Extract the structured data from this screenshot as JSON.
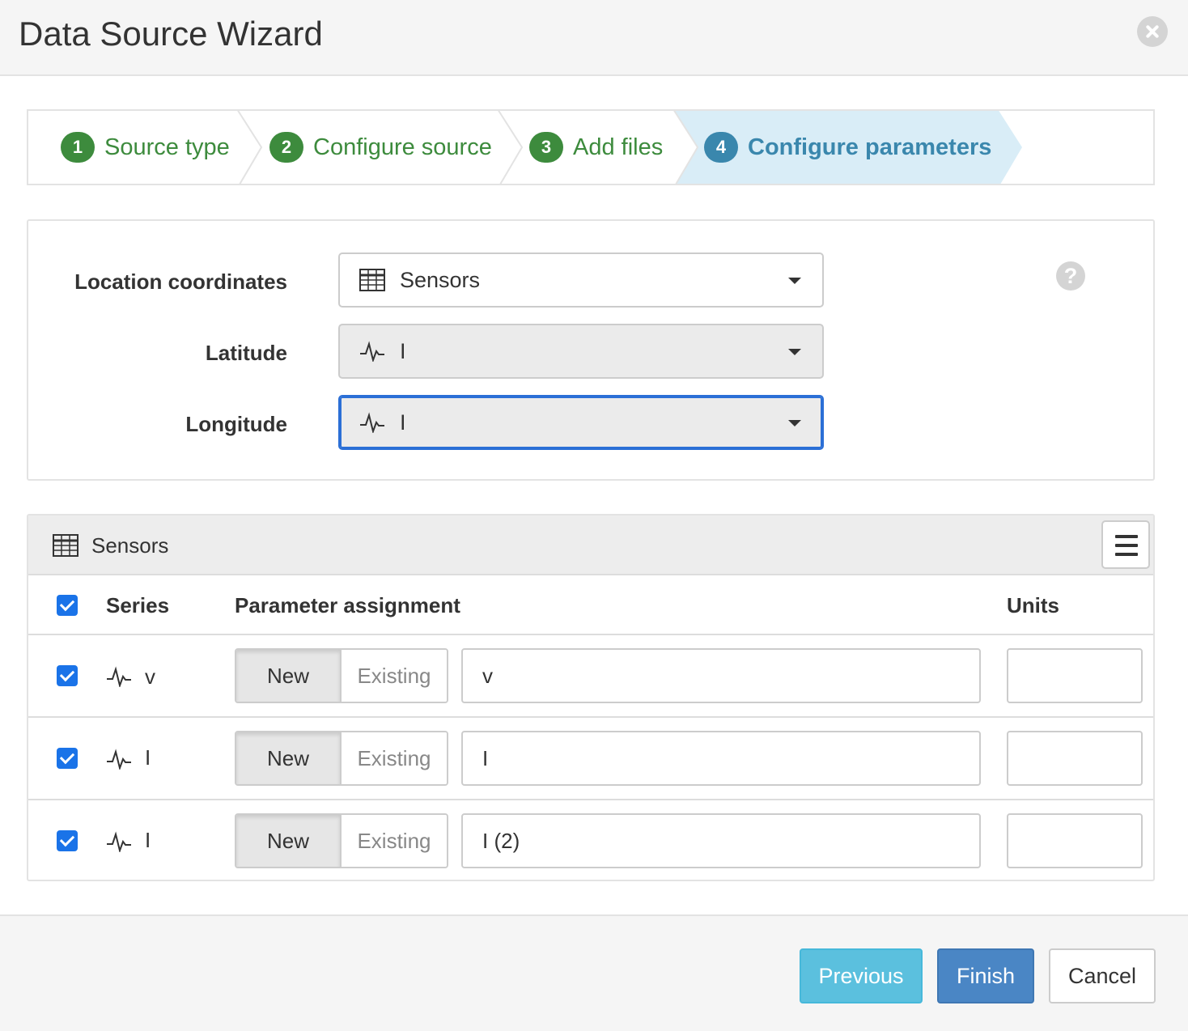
{
  "dialog": {
    "title": "Data Source Wizard"
  },
  "steps": [
    {
      "num": "1",
      "label": "Source type",
      "state": "done"
    },
    {
      "num": "2",
      "label": "Configure source",
      "state": "done"
    },
    {
      "num": "3",
      "label": "Add files",
      "state": "done"
    },
    {
      "num": "4",
      "label": "Configure parameters",
      "state": "active"
    }
  ],
  "location": {
    "coords_label": "Location coordinates",
    "coords_value": "Sensors",
    "lat_label": "Latitude",
    "lat_value": "I",
    "lon_label": "Longitude",
    "lon_value": "I",
    "help_icon": "?"
  },
  "sensors": {
    "title": "Sensors",
    "headers": {
      "series": "Series",
      "assignment": "Parameter assignment",
      "units": "Units"
    },
    "rows": [
      {
        "series": "v",
        "new": "New",
        "existing": "Existing",
        "param": "v",
        "units": ""
      },
      {
        "series": "I",
        "new": "New",
        "existing": "Existing",
        "param": "I",
        "units": ""
      },
      {
        "series": "I",
        "new": "New",
        "existing": "Existing",
        "param": "I (2)",
        "units": ""
      }
    ]
  },
  "footer": {
    "previous": "Previous",
    "finish": "Finish",
    "cancel": "Cancel"
  },
  "colors": {
    "step_done": "#3d8b3d",
    "step_active_bg": "#d9edf7",
    "step_active_text": "#3a87ad",
    "checkbox": "#1a73e8",
    "previous_btn": "#5bc0de",
    "finish_btn": "#4a86c5"
  },
  "icons": {
    "table": "table-icon",
    "series": "waveform-icon",
    "menu": "hamburger-icon",
    "close": "close-icon",
    "help": "question-icon"
  }
}
